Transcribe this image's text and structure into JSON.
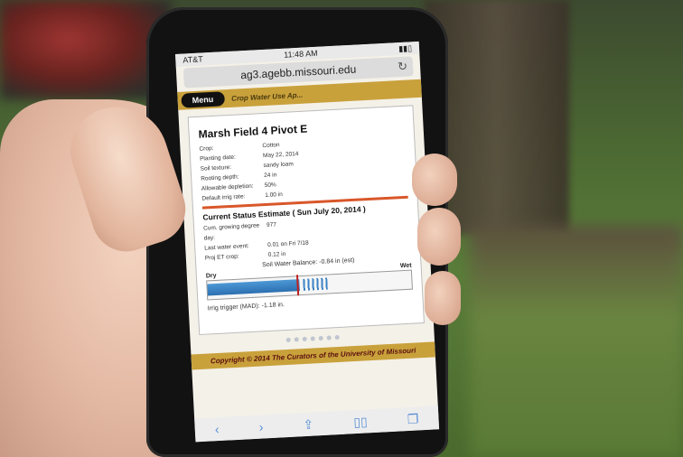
{
  "status": {
    "carrier": "AT&T",
    "time": "11:48 AM"
  },
  "browser": {
    "url": "ag3.agebb.missouri.edu"
  },
  "nav": {
    "menu_label": "Menu",
    "title": "Crop Water Use Ap..."
  },
  "field": {
    "title": "Marsh Field 4 Pivot E",
    "rows": [
      {
        "key": "Crop:",
        "value": "Cotton"
      },
      {
        "key": "Planting date:",
        "value": "May 22, 2014"
      },
      {
        "key": "Soil texture:",
        "value": "sandy loam"
      },
      {
        "key": "Rooting depth:",
        "value": "24 in"
      },
      {
        "key": "Allowable depletion:",
        "value": "50%"
      },
      {
        "key": "Default irrig rate:",
        "value": "1.00 in"
      }
    ]
  },
  "status_section": {
    "title": "Current Status Estimate ( Sun July 20, 2014 )",
    "rows": [
      {
        "key": "Cum. growing degree day:",
        "value": "977"
      },
      {
        "key": "Last water event:",
        "value": "0.01 on Fri 7/18"
      },
      {
        "key": "",
        "value": "0.12 in"
      },
      {
        "key": "Proj ET crop:",
        "value": ""
      }
    ],
    "balance_text": "Soil Water Balance: -0.84 in (est)",
    "dry_label": "Dry",
    "wet_label": "Wet",
    "gauge_level_percent": 45,
    "trigger_text": "Irrig trigger (MAD): -1.18 in."
  },
  "footer": {
    "text": "Copyright © 2014 The Curators of the University of Missouri"
  },
  "colors": {
    "accent": "#c9a13b",
    "divider": "#d9572a",
    "gauge": "#2c6fb0"
  }
}
